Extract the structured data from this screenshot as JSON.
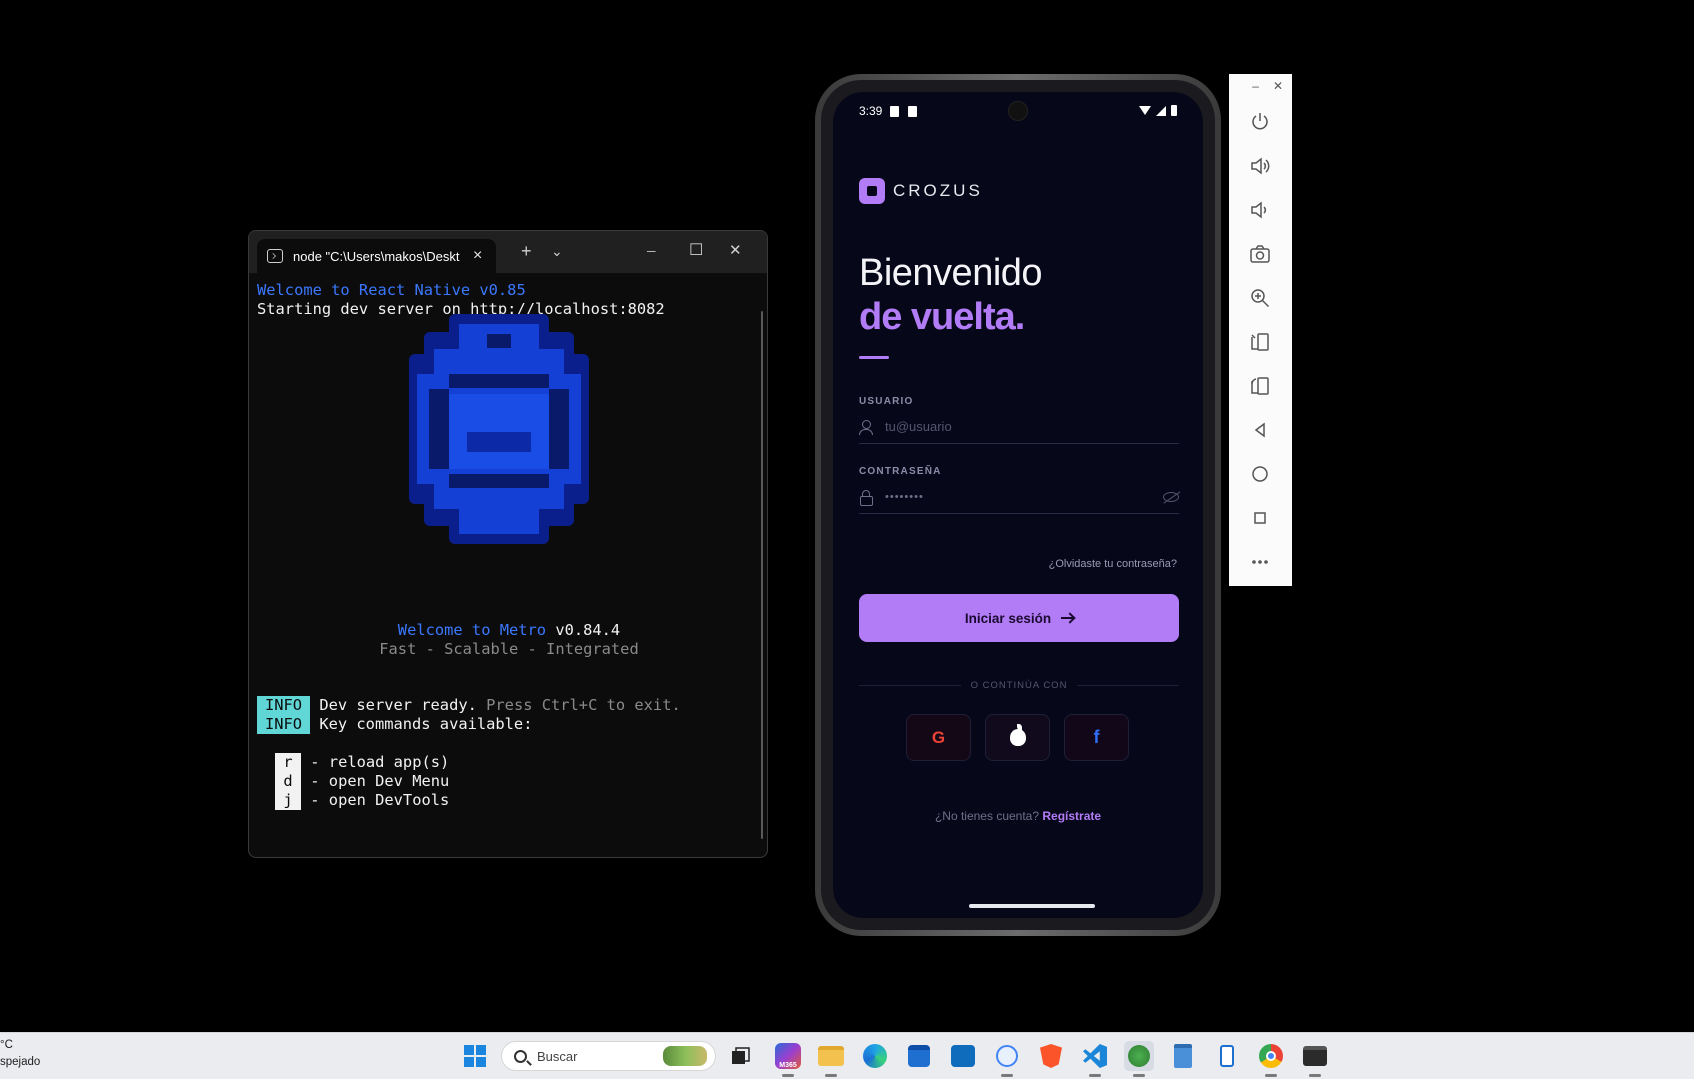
{
  "terminal": {
    "tab_title": "node  \"C:\\Users\\makos\\Deskt",
    "tab_close": "×",
    "new_tab": "+",
    "dropdown": "⌄",
    "minimize": "─",
    "maximize": "☐",
    "close": "✕",
    "lines": {
      "welcome_rn": "Welcome to React Native v0.85",
      "dev_server": "Starting dev server on http://localhost:8082",
      "welcome_metro_prefix": "Welcome to Metro",
      "metro_version": " v0.84.4",
      "tagline": "Fast - Scalable - Integrated",
      "info_tag": "INFO",
      "info1_main": " Dev server ready.",
      "info1_hint": " Press Ctrl+C to exit.",
      "info2_main": " Key commands available:",
      "cmd_r_key": "r",
      "cmd_r_label": " - reload app(s)",
      "cmd_d_key": "d",
      "cmd_d_label": " - open Dev Menu",
      "cmd_j_key": "j",
      "cmd_j_label": " - open DevTools"
    }
  },
  "phone": {
    "status_time": "3:39",
    "brand": "CROZUS",
    "title_line1": "Bienvenido",
    "title_line2": "de vuelta.",
    "username_label": "USUARIO",
    "username_placeholder": "tu@usuario",
    "password_label": "CONTRASEÑA",
    "password_value": "••••••••",
    "forgot": "¿Olvidaste tu contraseña?",
    "login_button": "Iniciar sesión",
    "divider": "O CONTINÚA CON",
    "social_google": "G",
    "social_facebook": "f",
    "signup_prompt": "¿No tienes cuenta?",
    "signup_link": "Regístrate",
    "accent_color": "#b27cf7"
  },
  "emulator": {
    "minimize": "–",
    "close": "✕",
    "buttons": [
      "power-icon",
      "volume-up-icon",
      "volume-down-icon",
      "camera-icon",
      "zoom-icon",
      "rotate-left-icon",
      "rotate-right-icon",
      "back-icon",
      "home-icon",
      "overview-icon",
      "more-icon"
    ]
  },
  "taskbar": {
    "weather_line1": "°C",
    "weather_line2": "spejado",
    "search_placeholder": "Buscar",
    "m365_label": "M365"
  }
}
